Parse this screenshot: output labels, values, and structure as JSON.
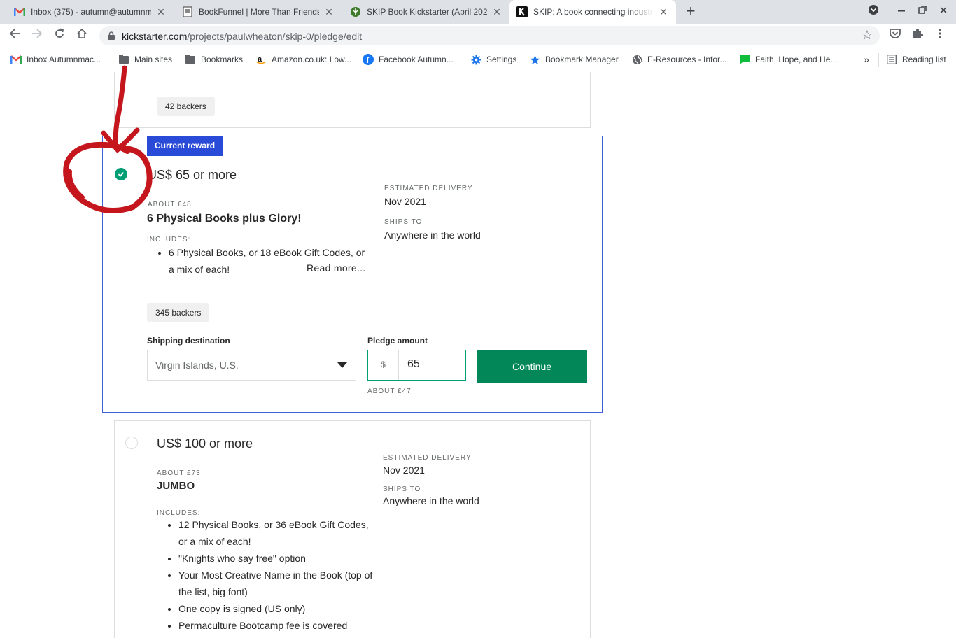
{
  "browser": {
    "tabs": [
      {
        "title": "Inbox (375) - autumn@autumnm",
        "icon": "gmail-icon"
      },
      {
        "title": "BookFunnel | More Than Friends",
        "icon": "bookfunnel-icon"
      },
      {
        "title": "SKIP Book Kickstarter (April 202",
        "icon": "permies-icon"
      },
      {
        "title": "SKIP: A book connecting industr",
        "icon": "kickstarter-icon",
        "active": true
      }
    ],
    "url_domain": "kickstarter.com",
    "url_path": "/projects/paulwheaton/skip-0/pledge/edit",
    "bookmarks": [
      {
        "label": "Inbox Autumnmac...",
        "icon": "gmail-icon"
      },
      {
        "label": "Main sites",
        "icon": "folder-icon"
      },
      {
        "label": "Bookmarks",
        "icon": "folder-icon"
      },
      {
        "label": "Amazon.co.uk: Low...",
        "icon": "amazon-icon"
      },
      {
        "label": "Facebook  Autumn...",
        "icon": "facebook-icon"
      },
      {
        "label": "Settings",
        "icon": "gear-icon"
      },
      {
        "label": "Bookmark Manager",
        "icon": "star-icon"
      },
      {
        "label": "E-Resources - Infor...",
        "icon": "globe-icon"
      },
      {
        "label": "Faith, Hope, and He...",
        "icon": "chat-icon"
      }
    ],
    "more_bookmarks": "»",
    "reading_list": "Reading list"
  },
  "rewards": {
    "prev": {
      "backers": "42 backers"
    },
    "current": {
      "badge": "Current reward",
      "price": "US$ 65 or more",
      "about": "ABOUT £48",
      "title": "6 Physical Books plus Glory!",
      "includes_label": "INCLUDES:",
      "includes": [
        "6 Physical Books, or 18 eBook Gift Codes, or a mix of each!"
      ],
      "read_more": "Read more...",
      "delivery_label": "ESTIMATED DELIVERY",
      "delivery": "Nov 2021",
      "ships_label": "SHIPS TO",
      "ships": "Anywhere in the world",
      "backers": "345 backers",
      "shipping_label": "Shipping destination",
      "shipping_value": "Virgin Islands, U.S.",
      "pledge_label": "Pledge amount",
      "currency": "$",
      "pledge_value": "65",
      "pledge_about": "ABOUT £47",
      "continue": "Continue"
    },
    "next": {
      "price": "US$ 100 or more",
      "about": "ABOUT £73",
      "title": "JUMBO",
      "includes_label": "INCLUDES:",
      "includes": [
        "12 Physical Books, or 36 eBook Gift Codes, or a mix of each!",
        "\"Knights who say free\" option",
        "Your Most Creative Name in the Book (top of the list, big font)",
        "One copy is signed (US only)",
        "Permaculture Bootcamp fee is covered"
      ],
      "delivery_label": "ESTIMATED DELIVERY",
      "delivery": "Nov 2021",
      "ships_label": "SHIPS TO",
      "ships": "Anywhere in the world"
    }
  },
  "colors": {
    "accent_green": "#028858",
    "badge_blue": "#2a4bd7",
    "annotation_red": "#c4161c"
  }
}
